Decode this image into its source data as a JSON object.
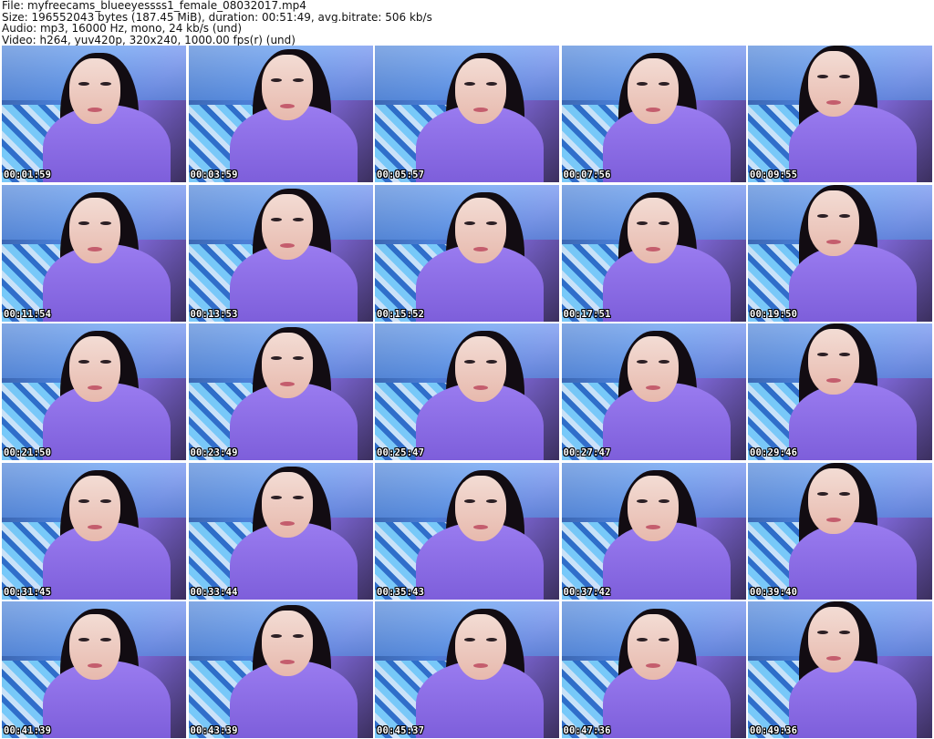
{
  "header": {
    "file_line": "File: myfreecams_blueeyessss1_female_08032017.mp4",
    "size_line": "Size: 196552043 bytes (187.45 MiB), duration: 00:51:49, avg.bitrate: 506 kb/s",
    "audio_line": "Audio: mp3, 16000 Hz, mono, 24 kb/s (und)",
    "video_line": "Video: h264, yuv420p, 320x240, 1000.00 fps(r) (und)"
  },
  "thumbnails": [
    {
      "timestamp": "00:01:59"
    },
    {
      "timestamp": "00:03:59"
    },
    {
      "timestamp": "00:05:57"
    },
    {
      "timestamp": "00:07:56"
    },
    {
      "timestamp": "00:09:55"
    },
    {
      "timestamp": "00:11:54"
    },
    {
      "timestamp": "00:13:53"
    },
    {
      "timestamp": "00:15:52"
    },
    {
      "timestamp": "00:17:51"
    },
    {
      "timestamp": "00:19:50"
    },
    {
      "timestamp": "00:21:50"
    },
    {
      "timestamp": "00:23:49"
    },
    {
      "timestamp": "00:25:47"
    },
    {
      "timestamp": "00:27:47"
    },
    {
      "timestamp": "00:29:46"
    },
    {
      "timestamp": "00:31:45"
    },
    {
      "timestamp": "00:33:44"
    },
    {
      "timestamp": "00:35:43"
    },
    {
      "timestamp": "00:37:42"
    },
    {
      "timestamp": "00:39:40"
    },
    {
      "timestamp": "00:41:39"
    },
    {
      "timestamp": "00:43:39"
    },
    {
      "timestamp": "00:45:37"
    },
    {
      "timestamp": "00:47:36"
    },
    {
      "timestamp": "00:49:36"
    }
  ]
}
